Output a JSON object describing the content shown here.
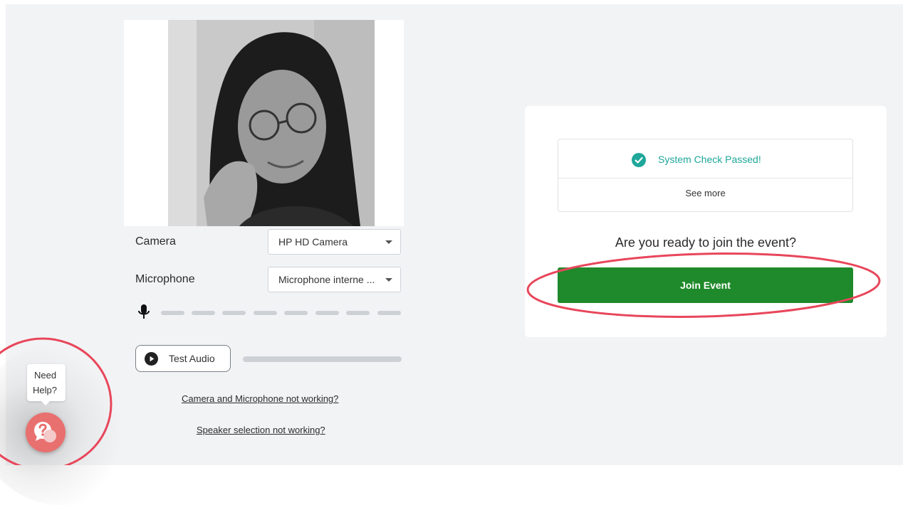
{
  "device_settings": {
    "camera_label": "Camera",
    "camera_value": "HP HD Camera",
    "microphone_label": "Microphone",
    "microphone_value": "Microphone interne ...",
    "mic_meter_segments": 8
  },
  "test_audio": {
    "button_label": "Test Audio"
  },
  "help_links": {
    "camera_mic": "Camera and Microphone not working?",
    "speaker": "Speaker selection not working?"
  },
  "help_widget": {
    "tooltip_line1": "Need",
    "tooltip_line2": "Help?"
  },
  "system_check": {
    "status_text": "System Check Passed!",
    "see_more_label": "See more"
  },
  "join": {
    "heading": "Are you ready to join the event?",
    "button_label": "Join Event"
  },
  "colors": {
    "accent_teal": "#1ea79a",
    "join_green": "#1f8a2b",
    "annotation_red": "#e8465a",
    "help_bubble": "#e8706f"
  }
}
